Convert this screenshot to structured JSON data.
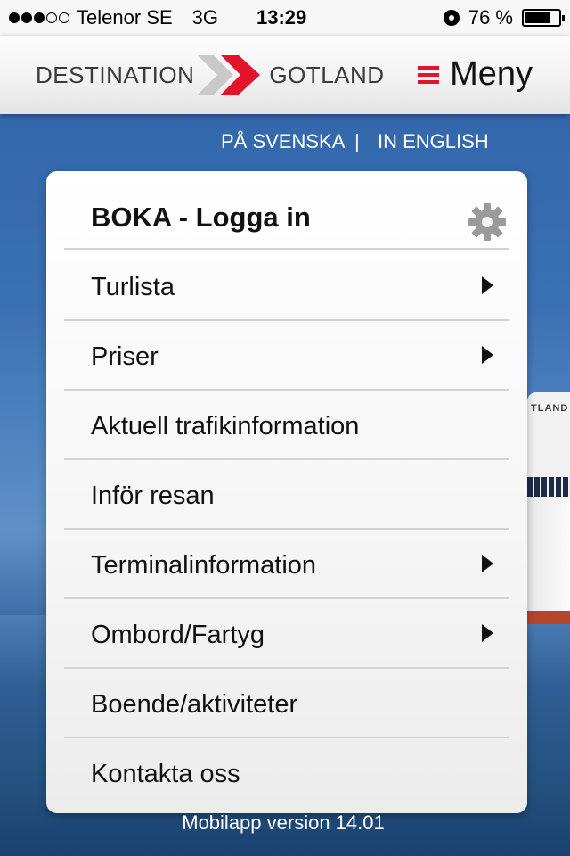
{
  "status_bar": {
    "carrier": "Telenor SE",
    "network": "3G",
    "time": "13:29",
    "battery": "76 %",
    "battery_level": 0.76,
    "signal_bars_filled": 3,
    "signal_bars_total": 5
  },
  "header": {
    "logo_left": "DESTINATION",
    "logo_right": "GOTLAND",
    "menu_label": "Meny",
    "accent_color": "#e3132b"
  },
  "language": {
    "swedish": "PÅ SVENSKA",
    "separator": "|",
    "english": "IN ENGLISH"
  },
  "menu": {
    "items": [
      {
        "label": "BOKA - Logga in",
        "icon": "gear-icon"
      },
      {
        "label": "Turlista",
        "icon": "chevron-right-icon"
      },
      {
        "label": "Priser",
        "icon": "chevron-right-icon"
      },
      {
        "label": "Aktuell trafikinformation",
        "icon": ""
      },
      {
        "label": "Inför resan",
        "icon": ""
      },
      {
        "label": "Terminalinformation",
        "icon": "chevron-right-icon"
      },
      {
        "label": "Ombord/Fartyg",
        "icon": "chevron-right-icon"
      },
      {
        "label": "Boende/aktiviteter",
        "icon": ""
      },
      {
        "label": "Kontakta oss",
        "icon": ""
      }
    ]
  },
  "background": {
    "ship_text": "TLAND"
  },
  "footer": {
    "version": "Mobilapp version 14.01"
  }
}
